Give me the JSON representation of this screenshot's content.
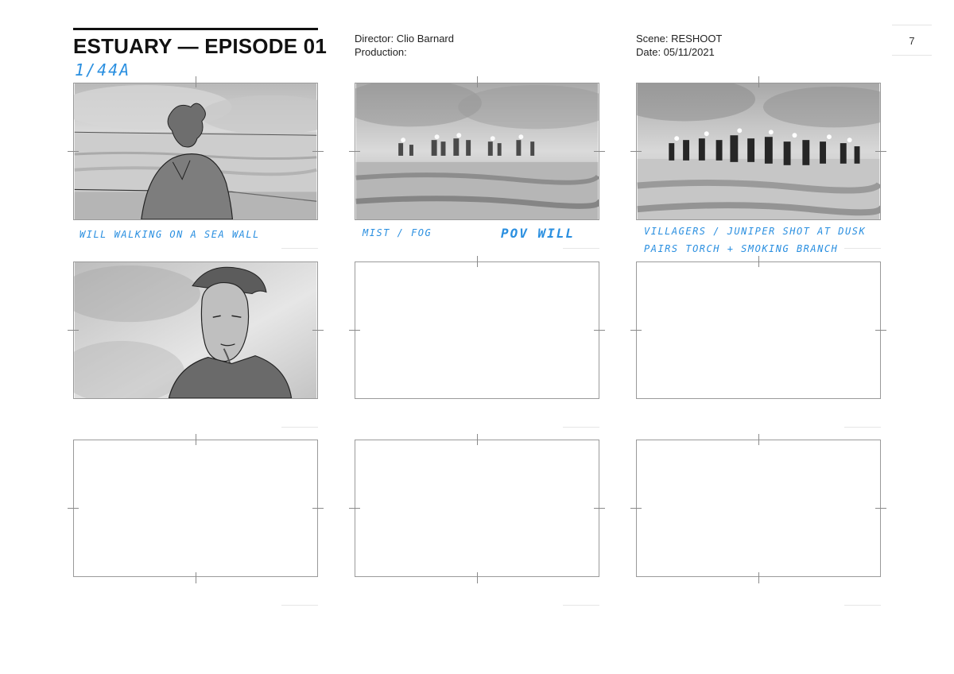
{
  "header": {
    "title": "ESTUARY — EPISODE 01",
    "shot_code": "1/44A",
    "director": "Director: Clio Barnard",
    "production": "Production:",
    "scene": "Scene: RESHOOT",
    "date": "Date: 05/11/2021",
    "page_number": "7"
  },
  "panels": [
    {
      "id": 1,
      "notes": [
        "WILL  WALKING ON A SEA WALL"
      ]
    },
    {
      "id": 2,
      "notes": [
        "MIST / FOG",
        "POV WILL"
      ]
    },
    {
      "id": 3,
      "notes": [
        "VILLAGERS / JUNIPER   SHOT AT DUSK",
        "PAIRS  TORCH + SMOKING BRANCH"
      ]
    },
    {
      "id": 4,
      "notes": []
    },
    {
      "id": 5,
      "notes": []
    },
    {
      "id": 6,
      "notes": []
    },
    {
      "id": 7,
      "notes": []
    },
    {
      "id": 8,
      "notes": []
    },
    {
      "id": 9,
      "notes": []
    }
  ],
  "colors": {
    "annotation_blue": "#2a8fe0",
    "frame_border": "#9a9a9a"
  }
}
